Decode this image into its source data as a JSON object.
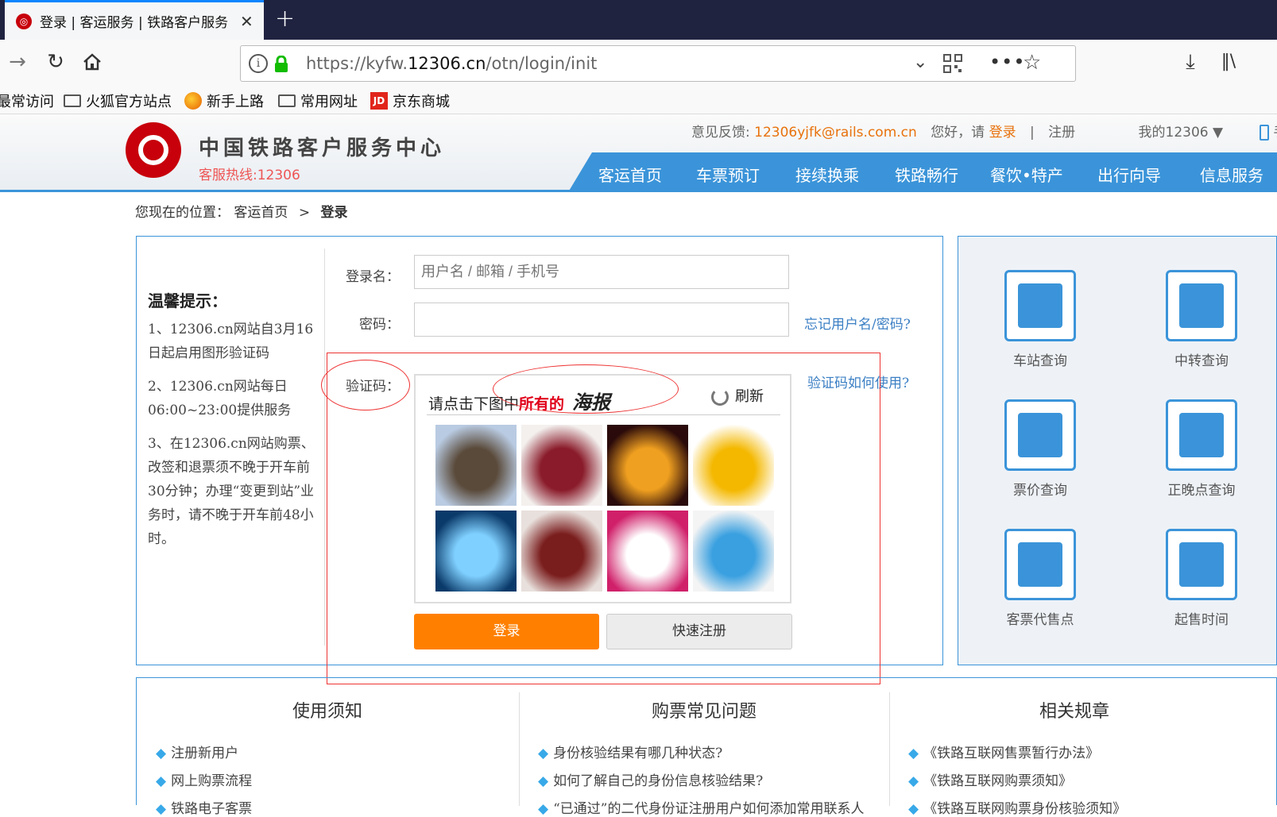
{
  "browser": {
    "tab_title": "登录 | 客运服务 | 铁路客户服务",
    "tab_close": "✕",
    "new_tab": "+",
    "url_prefix": "https://kyfw.",
    "url_domain": "12306.cn",
    "url_path": "/otn/login/init",
    "bookmarks": [
      "最常访问",
      "火狐官方站点",
      "新手上路",
      "常用网址",
      "京东商城"
    ]
  },
  "site": {
    "name": "中国铁路客户服务中心",
    "hotline": "客服热线:12306",
    "feedback_label": "意见反馈:",
    "feedback_email": "12306yjfk@rails.com.cn",
    "greeting": "您好，请",
    "login_link": "登录",
    "divider": "|",
    "register_link": "注册",
    "my12306": "我的12306",
    "mobile": "手机",
    "nav": [
      "客运首页",
      "车票预订",
      "接续换乘",
      "铁路畅行",
      "餐饮•特产",
      "出行向导",
      "信息服务"
    ]
  },
  "breadcrumb": {
    "prefix": "您现在的位置：",
    "home": "客运首页",
    "sep": ">",
    "current": "登录"
  },
  "tips": {
    "title": "温馨提示：",
    "items": [
      "1、12306.cn网站自3月16日起启用图形验证码",
      "2、12306.cn网站每日06:00~23:00提供服务",
      "3、在12306.cn网站购票、改签和退票须不晚于开车前30分钟；办理“变更到站”业务时，请不晚于开车前48小时。"
    ]
  },
  "form": {
    "username_label": "登录名：",
    "username_placeholder": "用户名 / 邮箱 / 手机号",
    "password_label": "密码：",
    "forgot_link": "忘记用户名/密码?",
    "captcha_label": "验证码：",
    "captcha_help_link": "验证码如何使用?",
    "captcha_prompt": "请点击下图中",
    "captcha_prompt_red": "所有的",
    "captcha_word": "海报",
    "refresh_label": "刷新",
    "login_button": "登录",
    "register_button": "快速注册"
  },
  "captcha_images": [
    {
      "name": "gate",
      "colors": [
        "#b9cbe2",
        "#5a4a3a"
      ]
    },
    {
      "name": "heart-beans",
      "colors": [
        "#f3f0ee",
        "#8a1b2a"
      ]
    },
    {
      "name": "stage-poster",
      "colors": [
        "#2a0a0a",
        "#f0a020"
      ]
    },
    {
      "name": "fries",
      "colors": [
        "#ffffff",
        "#f4b800"
      ]
    },
    {
      "name": "blue-poster",
      "colors": [
        "#0a3a6a",
        "#7fd0ff"
      ]
    },
    {
      "name": "red-beans",
      "colors": [
        "#e8e0dc",
        "#7a1d1d"
      ]
    },
    {
      "name": "pink-poster",
      "colors": [
        "#d0206a",
        "#ffffff"
      ]
    },
    {
      "name": "whistle",
      "colors": [
        "#f4f4f4",
        "#3aa0e0"
      ]
    }
  ],
  "services": [
    {
      "label": "车站查询",
      "icon": "station-icon"
    },
    {
      "label": "中转查询",
      "icon": "transfer-icon"
    },
    {
      "label": "票价查询",
      "icon": "price-search-icon"
    },
    {
      "label": "正晚点查询",
      "icon": "clock-icon"
    },
    {
      "label": "客票代售点",
      "icon": "ticket-agent-icon"
    },
    {
      "label": "起售时间",
      "icon": "sale-time-icon"
    }
  ],
  "bottom": {
    "col1": {
      "title": "使用须知",
      "items": [
        "注册新用户",
        "网上购票流程",
        "铁路电子客票"
      ]
    },
    "col2": {
      "title": "购票常见问题",
      "items": [
        "身份核验结果有哪几种状态?",
        "如何了解自己的身份信息核验结果?",
        "“已通过”的二代身份证注册用户如何添加常用联系人"
      ]
    },
    "col3": {
      "title": "相关规章",
      "items": [
        "《铁路互联网售票暂行办法》",
        "《铁路互联网购票须知》",
        "《铁路互联网购票身份核验须知》"
      ]
    }
  }
}
